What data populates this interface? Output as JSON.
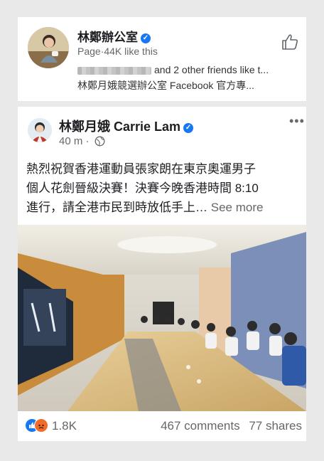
{
  "page_card": {
    "name": "林鄭辦公室",
    "meta": "Page·44K like this",
    "friends_text": "and 2 other friends like t...",
    "description": "林鄭月娥競選辦公室 Facebook 官方專..."
  },
  "post": {
    "author": "林鄭月娥 Carrie Lam",
    "time": "40 m ·",
    "text_lines": [
      "熱烈祝賀香港運動員張家朗在東京奧運男子",
      "個人花劍晉級決賽！決賽今晚香港時間 8:10",
      "進行，請全港市民到時放低手上…"
    ],
    "see_more": "See more",
    "reactions_count": "1.8K",
    "comments": "467 comments",
    "shares": "77 shares"
  },
  "colors": {
    "background": "#e9e9e9",
    "brand_blue": "#1877f2",
    "secondary_text": "#65676b"
  }
}
